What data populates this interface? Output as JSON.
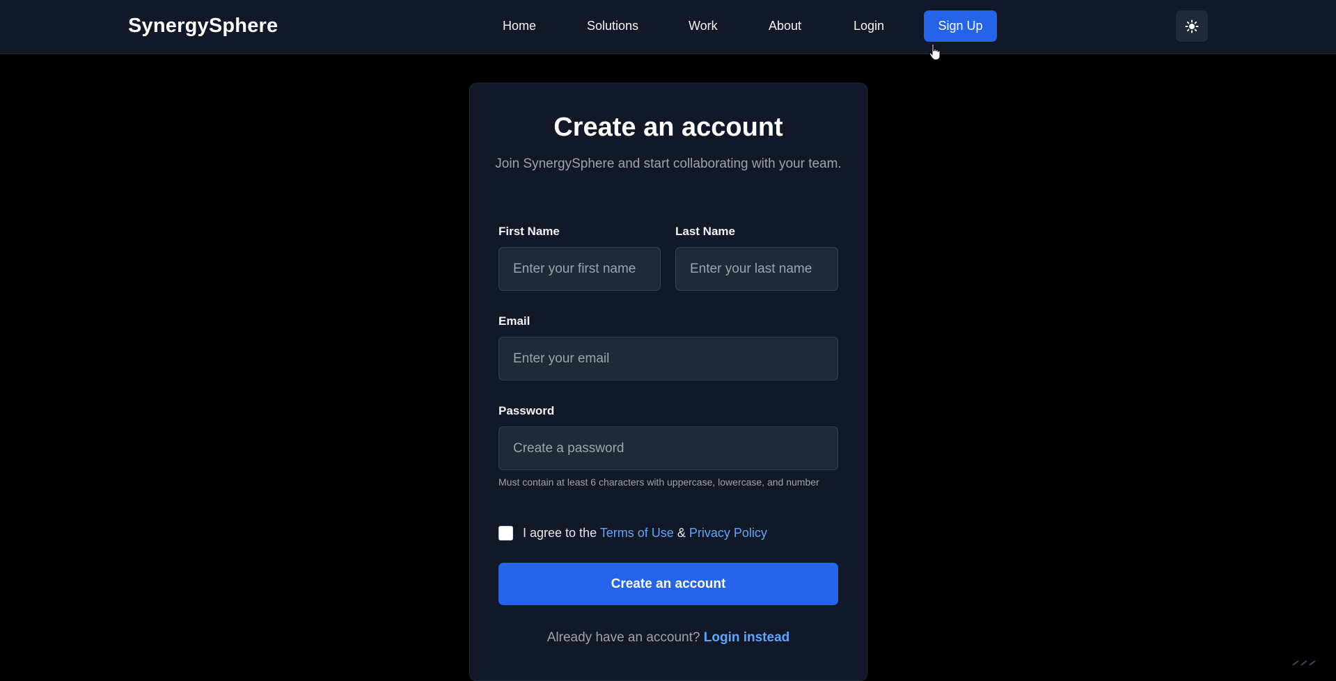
{
  "header": {
    "brand": "SynergySphere",
    "nav": [
      {
        "label": "Home"
      },
      {
        "label": "Solutions"
      },
      {
        "label": "Work"
      },
      {
        "label": "About"
      },
      {
        "label": "Login"
      }
    ],
    "signup_label": "Sign Up",
    "theme_icon": "sun-icon"
  },
  "form": {
    "title": "Create an account",
    "subtitle": "Join SynergySphere and start collaborating with your team.",
    "first_name": {
      "label": "First Name",
      "placeholder": "Enter your first name",
      "value": ""
    },
    "last_name": {
      "label": "Last Name",
      "placeholder": "Enter your last name",
      "value": ""
    },
    "email": {
      "label": "Email",
      "placeholder": "Enter your email",
      "value": ""
    },
    "password": {
      "label": "Password",
      "placeholder": "Create a password",
      "value": "",
      "hint": "Must contain at least 6 characters with uppercase, lowercase, and number"
    },
    "agree": {
      "prefix": "I agree to the",
      "terms": "Terms of Use",
      "amp": "&",
      "privacy": "Privacy Policy",
      "checked": false
    },
    "submit_label": "Create an account",
    "footer_prefix": "Already have an account?",
    "footer_link": "Login instead"
  },
  "colors": {
    "background": "#000000",
    "navbar": "#111827",
    "card": "#111827",
    "accent": "#2563eb",
    "link": "#60a5fa"
  }
}
